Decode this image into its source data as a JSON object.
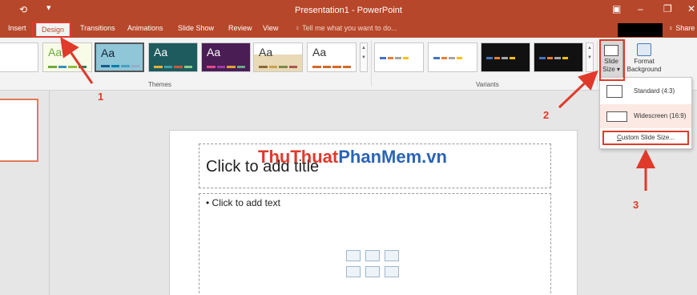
{
  "titlebar": {
    "title": "Presentation1 - PowerPoint",
    "qat_icon": "undo-icon",
    "qat_more": "▾"
  },
  "tabs": [
    {
      "label": "Insert"
    },
    {
      "label": "Design"
    },
    {
      "label": "Transitions"
    },
    {
      "label": "Animations"
    },
    {
      "label": "Slide Show"
    },
    {
      "label": "Review"
    },
    {
      "label": "View"
    }
  ],
  "tell_me": "♀ Tell me what you want to do...",
  "share": "♀ Share",
  "ribbon": {
    "themes_label": "Themes",
    "variants_label": "Variants",
    "theme_sample": "Aa",
    "slide_size_label": "Slide Size ▾",
    "format_background_label": "Format Background"
  },
  "slide": {
    "title_placeholder": "Click to add title",
    "body_placeholder": "• Click to add text"
  },
  "watermark": {
    "part1": "Thu",
    "part2": "Thuat",
    "part3": "PhanMem",
    "part4": ".vn"
  },
  "dropdown": {
    "standard": "Standard (4:3)",
    "widescreen": "Widescreen (16:9)",
    "custom_prefix": "C",
    "custom_rest": "ustom Slide Size..."
  },
  "annotations": {
    "n1": "1",
    "n2": "2",
    "n3": "3"
  },
  "colors": {
    "accent": "#b7472a",
    "annotation_red": "#e03a2b"
  }
}
